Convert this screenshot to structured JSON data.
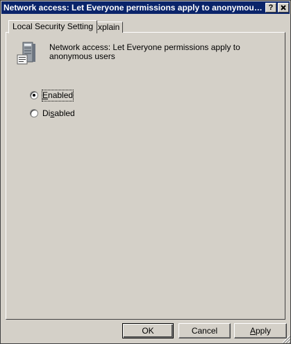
{
  "window": {
    "title": "Network access: Let Everyone permissions apply to anonymous users",
    "help_button": "?"
  },
  "tabs": [
    {
      "label": "Local Security Setting",
      "active": true
    },
    {
      "label": "Explain",
      "active": false
    }
  ],
  "policy": {
    "icon": "server-policy-icon",
    "description": "Network access: Let Everyone permissions apply to anonymous users"
  },
  "options": [
    {
      "label_prefix": "",
      "mnemonic": "E",
      "label_suffix": "nabled",
      "selected": true
    },
    {
      "label_prefix": "Di",
      "mnemonic": "s",
      "label_suffix": "abled",
      "selected": false
    }
  ],
  "buttons": {
    "ok": "OK",
    "cancel": "Cancel",
    "apply_prefix": "",
    "apply_mnemonic": "A",
    "apply_suffix": "pply"
  },
  "colors": {
    "titlebar": "#0a246a",
    "face": "#d4d0c8"
  }
}
